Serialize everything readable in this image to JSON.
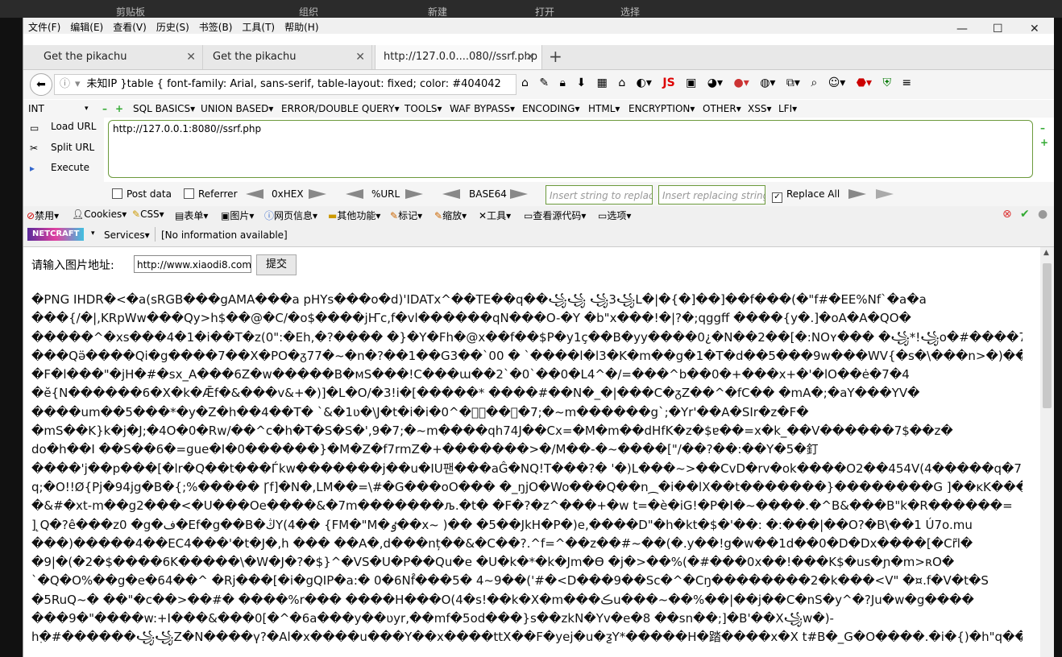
{
  "bg_ribbon": [
    "剪贴板",
    "组织",
    "新建",
    "打开",
    "选择"
  ],
  "menu": [
    "文件(F)",
    "编辑(E)",
    "查看(V)",
    "历史(S)",
    "书签(B)",
    "工具(T)",
    "帮助(H)"
  ],
  "window_controls": [
    "minimize-icon",
    "maximize-icon",
    "close-icon"
  ],
  "tabs": [
    {
      "label": "Get the pikachu",
      "active": false
    },
    {
      "label": "Get the pikachu",
      "active": false
    },
    {
      "label": "http://127.0.0....080//ssrf.php",
      "active": true
    }
  ],
  "address_bar": {
    "text": "未知IP   }table { font-family: Arial, sans-serif, table-layout: fixed; color: #404042"
  },
  "hackbar": {
    "type_select": "INT",
    "menus": [
      "SQL BASICS▾",
      "UNION BASED▾",
      "ERROR/DOUBLE QUERY▾",
      "TOOLS▾",
      "WAF BYPASS▾",
      "ENCODING▾",
      "HTML▾",
      "ENCRYPTION▾",
      "OTHER▾",
      "XSS▾",
      "LFI▾"
    ],
    "load_url": "Load URL",
    "split_url": "Split URL",
    "execute": "Execute",
    "url_value": "http://127.0.0.1:8080//ssrf.php",
    "post_data": "Post data",
    "referrer": "Referrer",
    "hex": "0xHEX",
    "url_enc": "%URL",
    "base64": "BASE64",
    "replace_placeholder": "Insert string to replace",
    "replacing_placeholder": "Insert replacing string",
    "replace_all": "Replace All"
  },
  "webdev_toolbar": [
    "禁用▾",
    "Cookies▾",
    "CSS▾",
    "表单▾",
    "图片▾",
    "网页信息▾",
    "其他功能▾",
    "标记▾",
    "缩放▾",
    "工具▾",
    "查看源代码▾",
    "选项▾"
  ],
  "netcraft": {
    "badge": "NETCRAFT",
    "services": "Services▾",
    "info": "[No information available]"
  },
  "page": {
    "label": "请输入图片地址:",
    "input_value": "http://www.xiaodi8.com/",
    "submit": "提交",
    "garbage_lines": [
      "�PNG  IHDR�<�a(sRGB���gAMA���a pHYs���o�d)'IDATx^��TE��q��꧁꧁ ꧁3꧁L�|�{�]��]��f���(�\"f#�EE%Nf`�a�a",
      "���{/�|,KRpWw���Qy>h$��@�C/�o$����jҤc,f�vl������qN���O-�Y �b\"x���!�|?�;qggff ����{y�.]�oA�A�QO�",
      "�����^�xs���4�1�i��T�z(0\":�Eh,�?���� �}�Y�Fh�@x��f��$P�y1ç��B�yy����0¿�N��2��[�:NOʏ���  �꧁*!꧁o�#����7",
      "���Qӛ����Qi�g����7��X�PO�ᵹ77�~�n�?��1��G3��`00 � `����l�l3�K�m��g�1�T�d��5���9w���WV{�s�\\���n>�)��",
      "�F�l���\"�jH�#�sx_A���6Z�w�����B�мS���!C���ɯ��2`�0`��0�L4^�/=���^b��0�+���x+�'�lO��ė�7�4",
      "�ĕ{N������6�X�k�Ǣf�&���v&+�)]�L�O/�3!i�[�����*   ����#��N�_�|���C�ᵹZ��^�fC�� �mA�;�aY���YV�",
      "����um��5���*�y�Z�h��4��T� `&�1ʋ�\\J�t�i�i�0^�ͯͯ��ͯ�7;�~m������g`;�Yr'��A�SIr�z�F�",
      "�mS��K}k�j�J;�4O�0�Rw/��^c�h�T�S�S�',9�7;�~m����qh74J��Cx=�M�m��dHfK�z�$ɐ��=x�k_��V������7$��z�",
      "do�h��I ��S��6�=ցue�I�0������}�M�Z�f7rmZ�+�������>�/M��-�~����[\"/��?��:��Y�5�釘",
      "����'j��p���[�lr�Q��t���Ѓkw�������j��u�IU팬���aĜ�NQ!T���?� '�)L���~>��CvD�rv�ok����O2��454V(4�����q�7",
      "q;�O!!Ø{Pj�94jg�B�{;%����� Ꞅf]�N�,LM��=\\#�G���oO��� �_ŋjO�Wo���Q��n⁔�i��lX��t�������}��������G ]��ĸK���",
      "�&#�xt-m��g2���<�U���Oe����&�7m�������љ.�t� �F�?�z^���+�w t=�è�iG!�P�I�~����.�^B&���B\"k�R������=",
      "] ̨Q�?ê���z0 �g�ف�Ef�g��B�ڭY(4�� {FM�\"M�ٶ��x~ )�� �5��JkH�P�)e,����D\"�h�kt�$�'��: �:���|��O?�B\\��1 Ú7o.mu",
      "���)�����4��EC4���'�t�J�,h ��� ��A�,d���nț��&�C��?.^f=^��z��#~��(�.y��!g�w��1d��0�D�Dx����[�Cr̃l�",
      "�9|�(�2�$����6K�����\\�W�J�?�$}^�VS�U�P��Qu�e �U�k�*�k�Jm�Ɵ �j�>��%(�#���0x��!���K$�us�ɲ�m>ʀO�",
      "`�Q�O%��g�e�64��^ �Rj���[�i�gQIP�a:� 0�6Nf̂���5� 4~9��('#�<D���9��Sc�^�Cŋ��������2�k���<V\" �¤.f�V�t�S",
      "�5RuQ~� ��\"�c��>��#� ����%r��� ����H���O(4�s!��k�X�m���ڪu���~��%��|��j��C�nS�y^�?Ju�w�g����",
      "���9�\"����w:+I���&���0[�^�6a���y��ʋyr,��mf�5od���}ѕ��zkN�Yv�e�8 ��sn��;]�B'��X꧁w�)-",
      "hٜ�#������꧁꧁Z�N����ү?�Al�x����u���Y��x����ttX��F�yej�u�ƺY*�����H�踏����x�X t#B�_G�O����.�i�{)�h\"q�� @h�"
    ]
  }
}
